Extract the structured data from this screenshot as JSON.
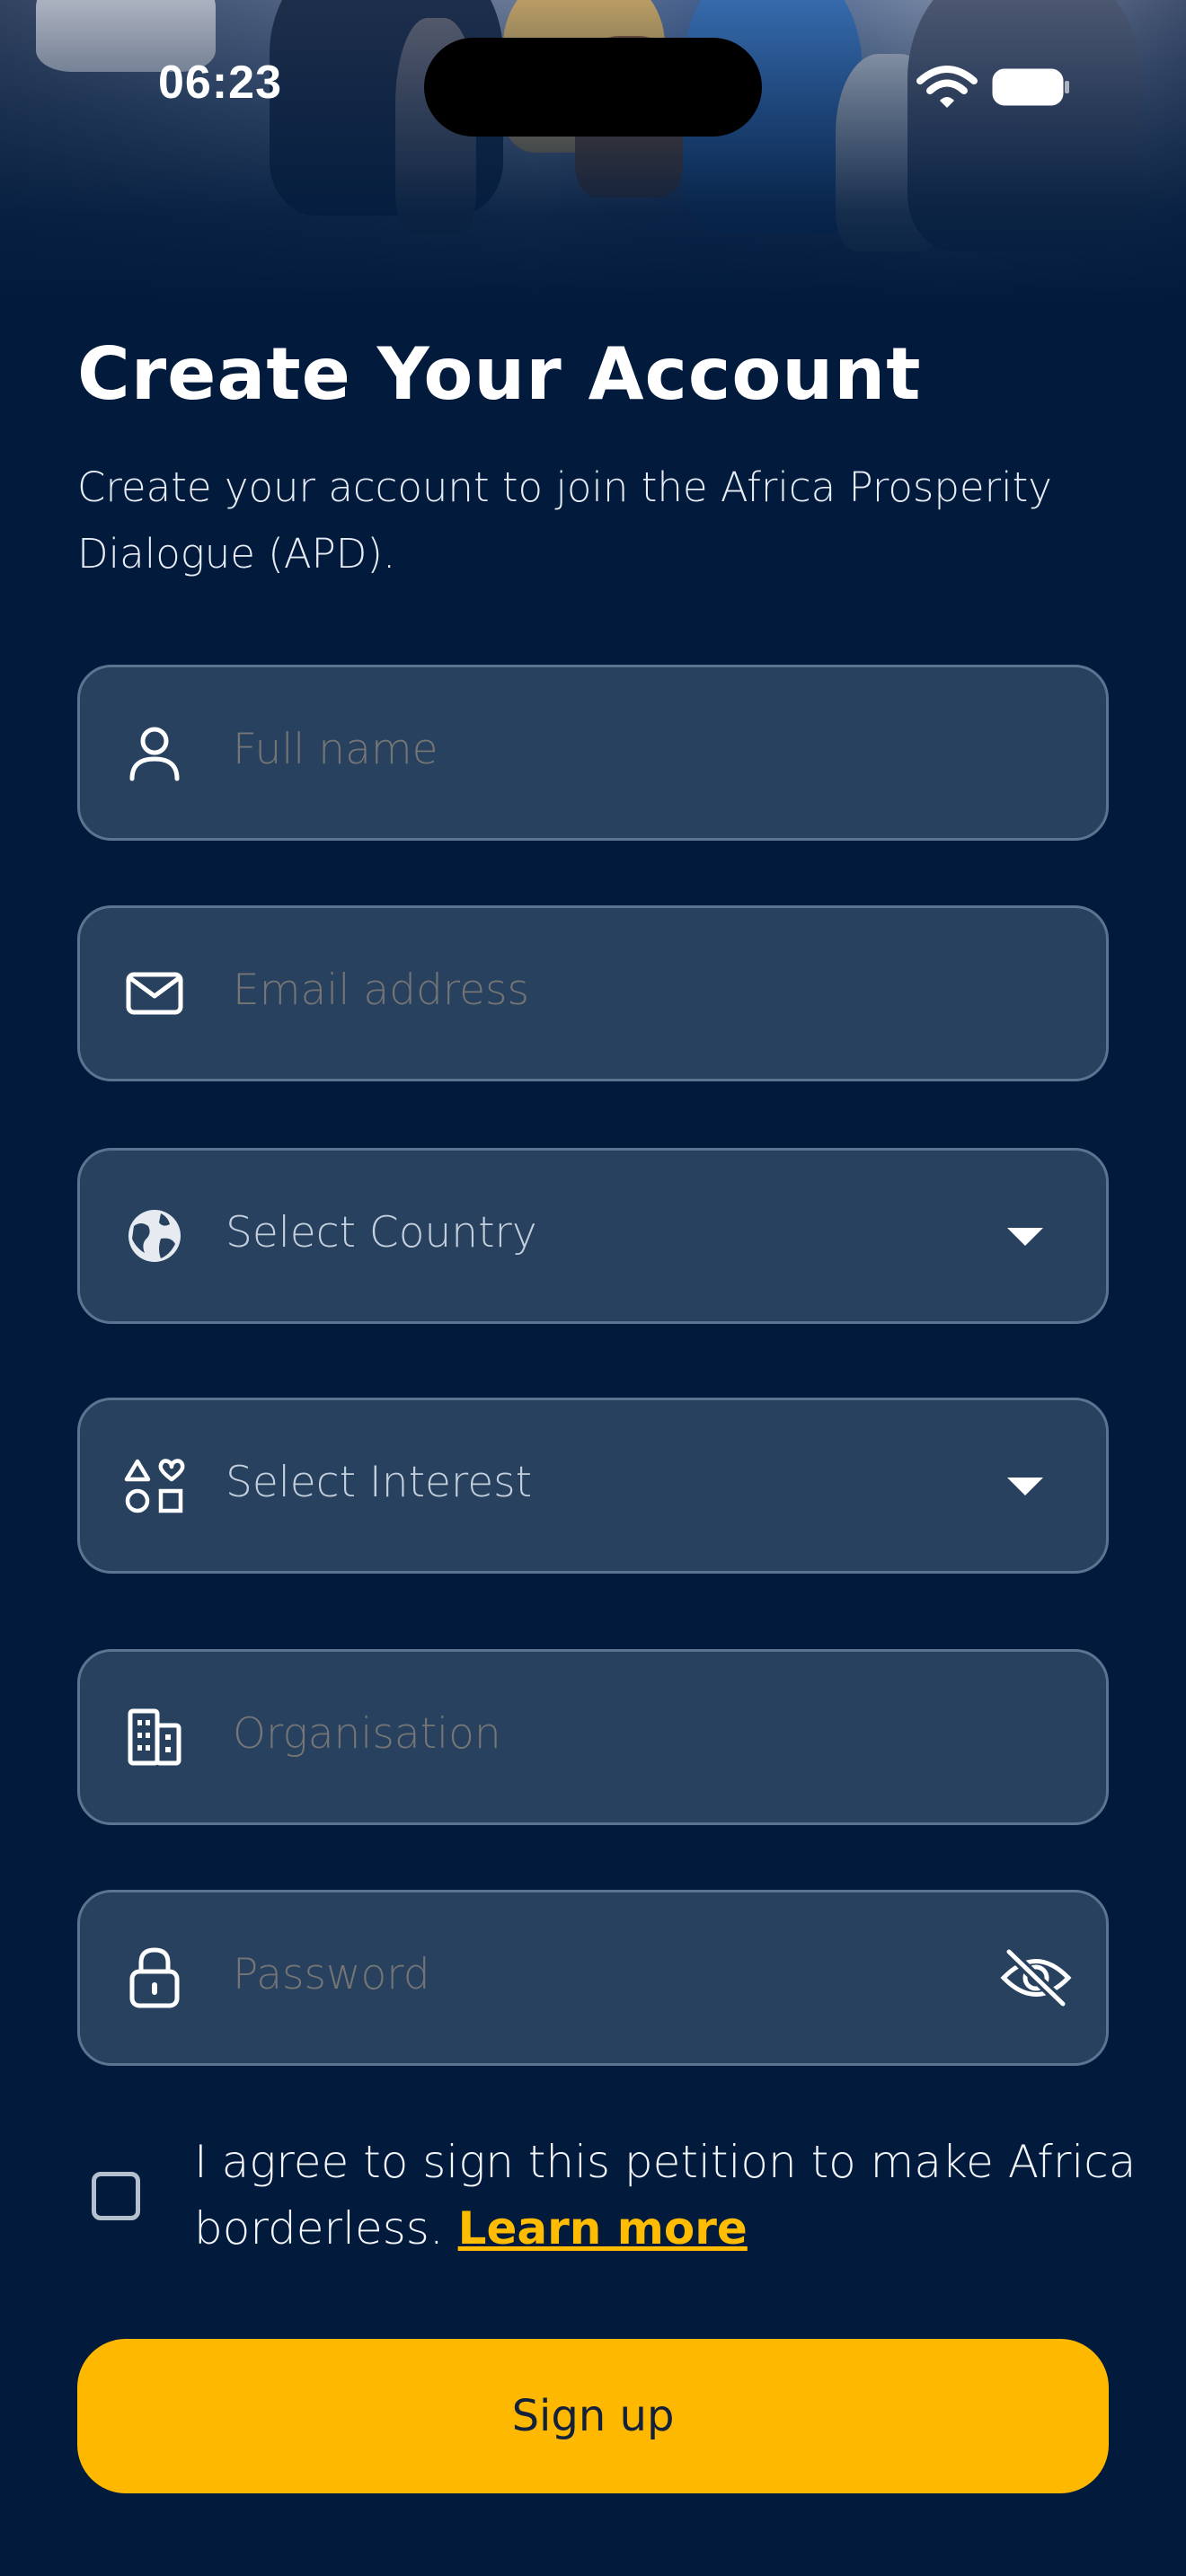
{
  "status_bar": {
    "time": "06:23"
  },
  "header": {
    "title": "Create Your Account",
    "subtitle": "Create your account to join the Africa Prosperity Dialogue (APD)."
  },
  "form": {
    "full_name": {
      "placeholder": "Full name",
      "icon": "user-icon"
    },
    "email": {
      "placeholder": "Email address",
      "icon": "mail-icon"
    },
    "country": {
      "selected": "Select Country",
      "icon": "globe-icon"
    },
    "interest": {
      "selected": "Select Interest",
      "icon": "shapes-icon"
    },
    "organisation": {
      "placeholder": "Organisation",
      "icon": "building-icon"
    },
    "password": {
      "placeholder": "Password",
      "icon": "lock-icon",
      "toggle_icon": "eye-off-icon"
    }
  },
  "agreement": {
    "text": "I agree to sign this petition to make Africa borderless.",
    "link": "Learn more",
    "checked": false
  },
  "actions": {
    "signup_label": "Sign up"
  },
  "colors": {
    "background": "#021b3d",
    "field_bg": "#27415f",
    "field_border": "#5c7391",
    "accent": "#ffb800",
    "link": "#ffbc00"
  }
}
